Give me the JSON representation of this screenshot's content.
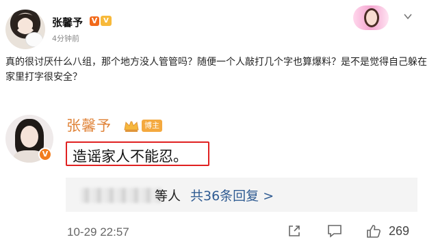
{
  "post": {
    "author_name": "张馨予",
    "verified_mark": "V",
    "vip_mark": "V",
    "time": "4分钟前",
    "body": "真的很讨厌什么八组，那个地方没人管管吗？随便一个人敲打几个字也算爆料？是不是觉得自己躲在家里打字很安全？"
  },
  "comment": {
    "author_name": "张馨予",
    "author_tag": "博主",
    "verified_mark": "V",
    "text": "造谣家人不能忍。",
    "reply_suffix": "等人",
    "reply_link": "共36条回复 >",
    "time": "10-29 22:57",
    "like_count": "269"
  },
  "colors": {
    "accent_orange": "#e0843a",
    "highlight_red": "#e02020",
    "link_blue": "#2f5b92"
  },
  "icons": [
    "chevron-down-icon",
    "crown-icon",
    "share-icon",
    "comment-icon",
    "like-icon"
  ]
}
